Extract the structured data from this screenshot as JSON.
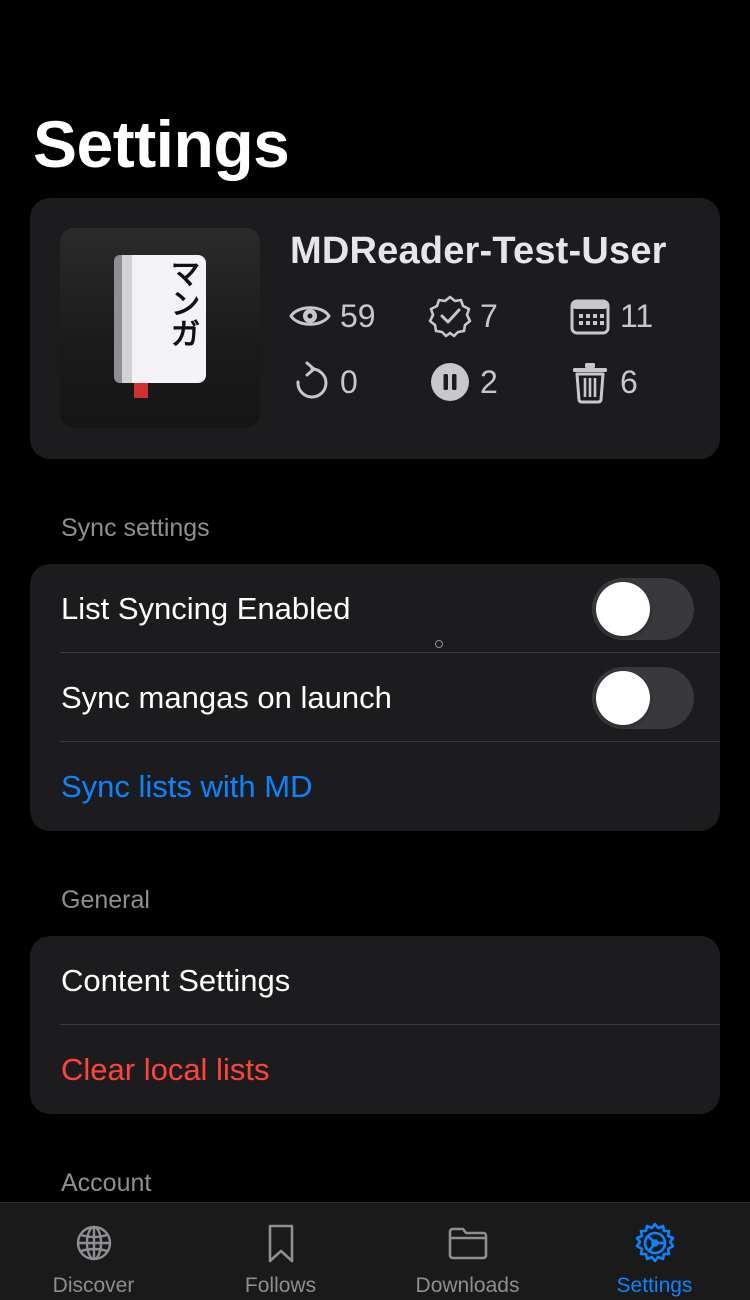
{
  "page": {
    "title": "Settings"
  },
  "profile": {
    "avatar_text": "マンガ",
    "username": "MDReader-Test-User",
    "stats": {
      "reading": {
        "icon": "eye-icon",
        "value": "59"
      },
      "completed": {
        "icon": "checkmark-seal-icon",
        "value": "7"
      },
      "plan_to_read": {
        "icon": "calendar-icon",
        "value": "11"
      },
      "rereading": {
        "icon": "reload-icon",
        "value": "0"
      },
      "on_hold": {
        "icon": "pause-circle-icon",
        "value": "2"
      },
      "dropped": {
        "icon": "trash-icon",
        "value": "6"
      }
    }
  },
  "sync_settings": {
    "header": "Sync settings",
    "list_syncing_label": "List Syncing Enabled",
    "list_syncing_on": false,
    "sync_on_launch_label": "Sync mangas on launch",
    "sync_on_launch_on": false,
    "sync_lists_label": "Sync lists with MD"
  },
  "general": {
    "header": "General",
    "content_settings_label": "Content Settings",
    "clear_local_lists_label": "Clear local lists"
  },
  "account": {
    "header": "Account"
  },
  "tabbar": {
    "tabs": [
      {
        "label": "Discover",
        "icon": "globe-icon",
        "active": false
      },
      {
        "label": "Follows",
        "icon": "bookmark-icon",
        "active": false
      },
      {
        "label": "Downloads",
        "icon": "folder-icon",
        "active": false
      },
      {
        "label": "Settings",
        "icon": "gear-icon",
        "active": true
      }
    ]
  },
  "colors": {
    "accent": "#0a84ff",
    "destructive": "#ff453a",
    "card": "#1c1c1e",
    "secondary_text": "#8e8e93"
  }
}
